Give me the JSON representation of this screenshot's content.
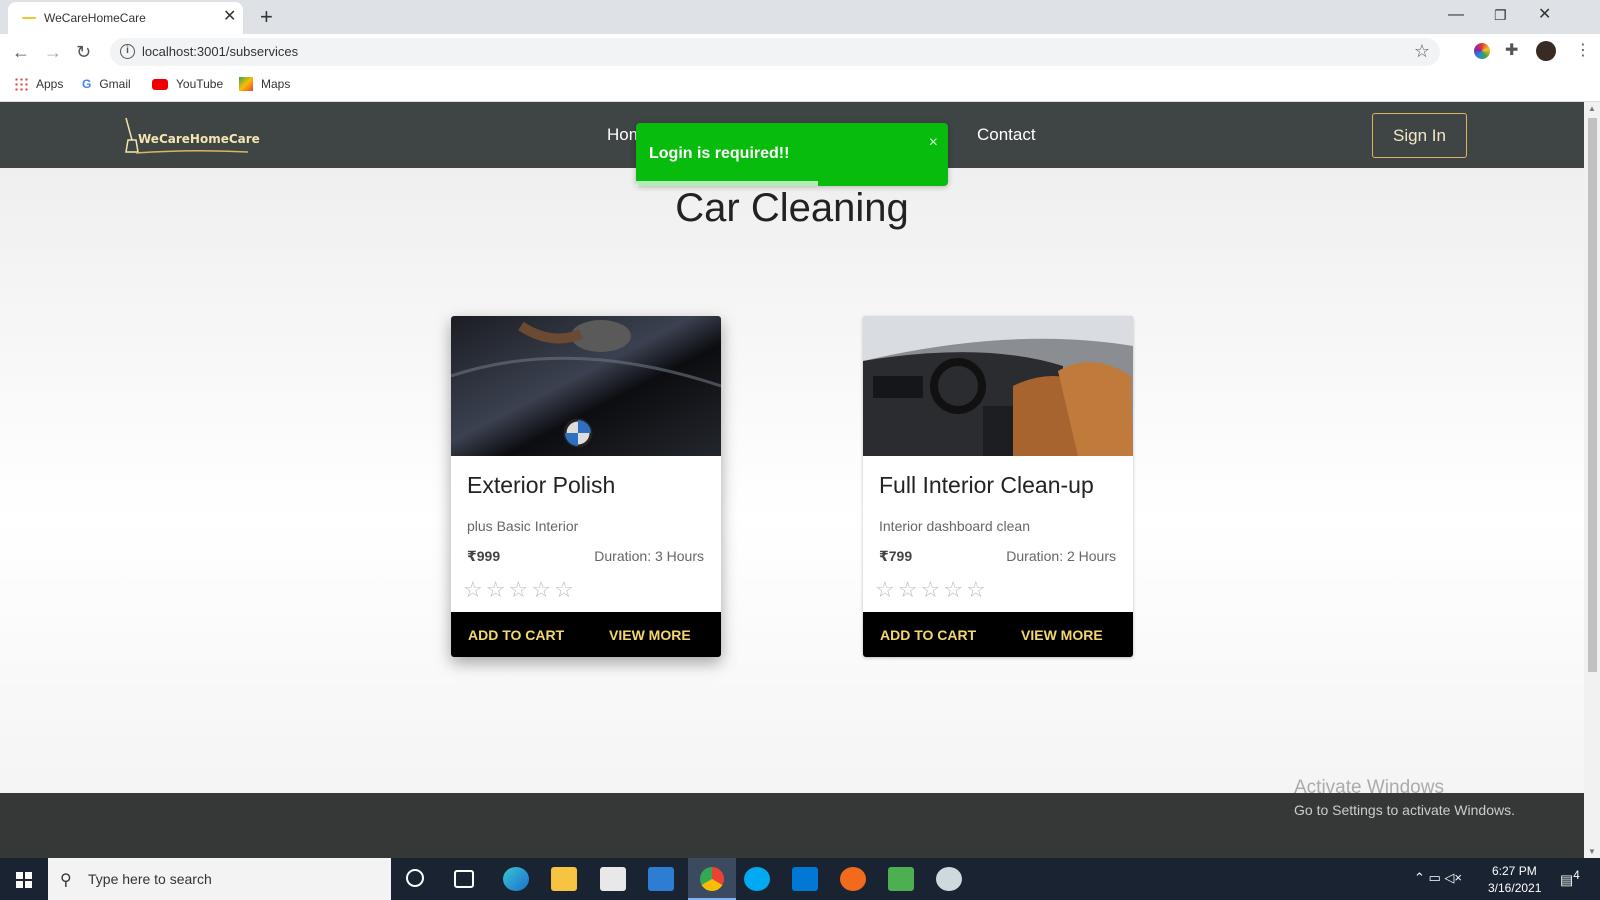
{
  "browser": {
    "tab_title": "WeCareHomeCare",
    "url": "localhost:3001/subservices",
    "bookmarks": [
      "Apps",
      "Gmail",
      "YouTube",
      "Maps"
    ]
  },
  "site": {
    "logo_text": "WeCareHomeCare",
    "nav_home": "Hom",
    "nav_contact": "Contact",
    "signin_label": "Sign In"
  },
  "toast": {
    "message": "Login is required!!",
    "close": "×",
    "color": "#07bc0c"
  },
  "page_title": "Car Cleaning",
  "cards": [
    {
      "title": "Exterior Polish",
      "subtitle": "plus Basic Interior",
      "price": "₹999",
      "duration": "Duration: 3 Hours",
      "rating": 0,
      "add_to_cart": "ADD TO CART",
      "view_more": "VIEW MORE",
      "image": "car-polish-photo"
    },
    {
      "title": "Full Interior Clean-up",
      "subtitle": "Interior dashboard clean",
      "price": "₹799",
      "duration": "Duration: 2 Hours",
      "rating": 0,
      "add_to_cart": "ADD TO CART",
      "view_more": "VIEW MORE",
      "image": "car-interior-photo"
    }
  ],
  "watermark": {
    "line1": "Activate Windows",
    "line2": "Go to Settings to activate Windows."
  },
  "taskbar": {
    "search_placeholder": "Type here to search",
    "time": "6:27 PM",
    "date": "3/16/2021",
    "notifications": "4"
  },
  "colors": {
    "navbar": "#3f4444",
    "accent_gold": "#f5d76e",
    "footer": "#363838"
  }
}
